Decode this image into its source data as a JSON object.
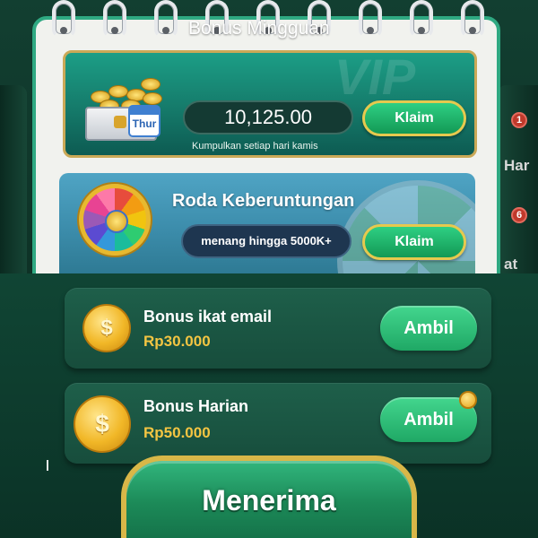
{
  "weekly_bonus": {
    "title": "Bonus Mingguan",
    "amount": "10,125.00",
    "subtitle": "Kumpulkan setiap hari kamis",
    "button_label": "Klaim",
    "day_badge": "Thur",
    "watermark": "VIP"
  },
  "lucky_wheel": {
    "title": "Roda Keberuntungan",
    "subtitle": "menang hingga 5000K+",
    "button_label": "Klaim"
  },
  "side_fragments": {
    "right_top": "Har",
    "right_bottom": "at",
    "badge_1": "1",
    "badge_2": "6"
  },
  "bonus_rows": [
    {
      "title": "Bonus ikat email",
      "amount": "Rp30.000",
      "button_label": "Ambil",
      "coin_symbol": "$"
    },
    {
      "title": "Bonus Harian",
      "amount": "Rp50.000",
      "button_label": "Ambil",
      "coin_symbol": "$"
    }
  ],
  "receive_button": {
    "label": "Menerima"
  },
  "colors": {
    "accent_green": "#1fa865",
    "gold": "#f4c542",
    "panel_teal": "#157a6a",
    "background": "#0c3a2b"
  }
}
